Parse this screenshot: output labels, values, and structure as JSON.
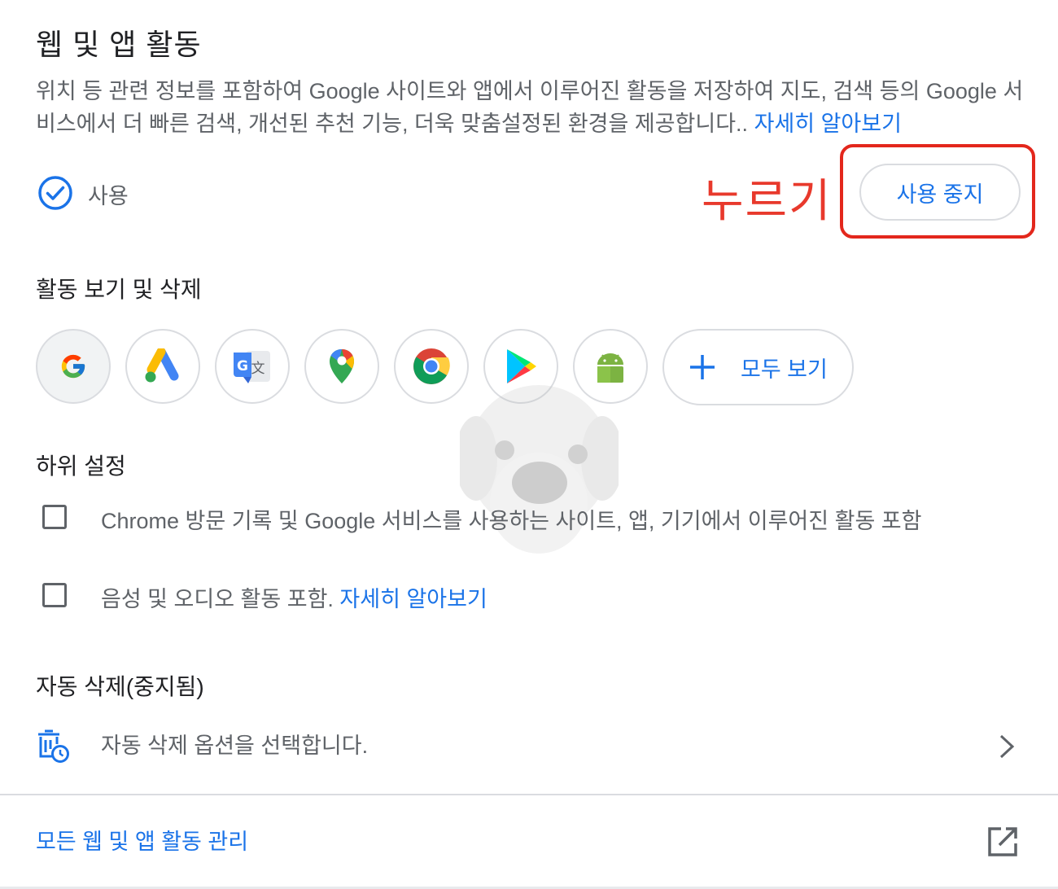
{
  "header": {
    "title": "웹 및 앱 활동",
    "description": "위치 등 관련 정보를 포함하여 Google 사이트와 앱에서 이루어진 활동을 저장하여 지도, 검색 등의 Google 서비스에서 더 빠른 검색, 개선된 추천 기능, 더욱 맞춤설정된 환경을 제공합니다.. ",
    "learn_more": "자세히 알아보기"
  },
  "status": {
    "label": "사용",
    "icon": "check-circle-icon",
    "pause_button": "사용 중지",
    "annotation": "누르기"
  },
  "activity": {
    "heading": "활동 보기 및 삭제",
    "apps": [
      {
        "icon": "google-icon"
      },
      {
        "icon": "google-ads-icon"
      },
      {
        "icon": "google-translate-icon"
      },
      {
        "icon": "google-maps-icon"
      },
      {
        "icon": "chrome-icon"
      },
      {
        "icon": "google-play-icon"
      },
      {
        "icon": "android-icon"
      }
    ],
    "see_all": "모두 보기"
  },
  "subsettings": {
    "heading": "하위 설정",
    "chrome_history": "Chrome 방문 기록 및 Google 서비스를 사용하는 사이트, 앱, 기기에서 이루어진 활동 포함",
    "audio_label": "음성 및 오디오 활동 포함. ",
    "audio_learn_more": "자세히 알아보기"
  },
  "auto_delete": {
    "heading": "자동 삭제(중지됨)",
    "option_label": "자동 삭제 옵션을 선택합니다."
  },
  "footer": {
    "manage_link": "모든 웹 및 앱 활동 관리"
  },
  "colors": {
    "accent": "#1a73e8",
    "annotation": "#e3271c",
    "border": "#dadce0",
    "text": "#5f6368"
  }
}
